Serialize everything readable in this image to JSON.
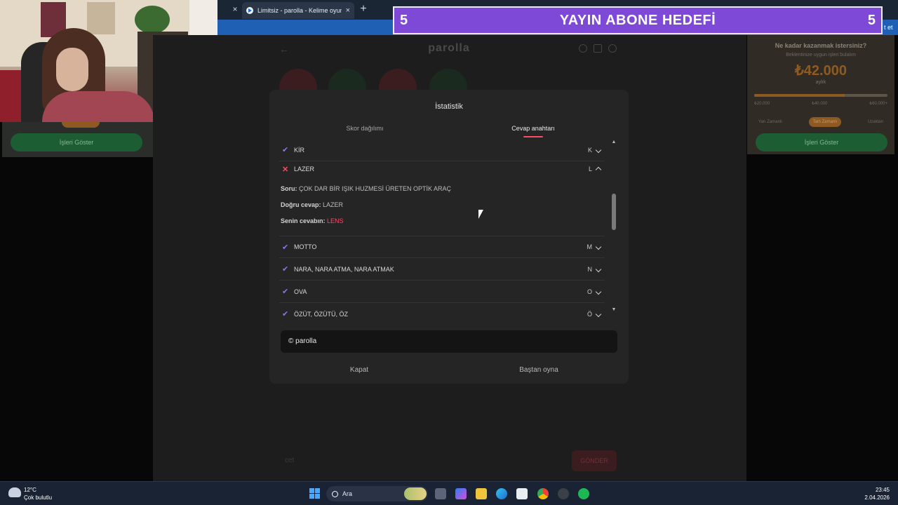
{
  "browser": {
    "prev_tab_close": "×",
    "active_tab": {
      "title": "Limitsiz - parolla - Kelime oyunu",
      "close": "×"
    },
    "new_tab": "+"
  },
  "goal_banner": {
    "left_count": "5",
    "title": "YAYIN ABONE HEDEFİ",
    "right_count": "5"
  },
  "corner_text": "t et",
  "ads": {
    "left_button": "İşleri Göster",
    "right": {
      "question": "Ne kadar kazanmak istersiniz?",
      "subtitle": "Beklentinize uygun işleri bulalım",
      "amount": "₺42.000",
      "period": "aylık",
      "progress": 0.68,
      "ticks": [
        "₺20.000",
        "₺40.000",
        "₺60.000+"
      ],
      "chips": [
        "Yarı Zamanlı",
        "Tam Zamanlı",
        "Uzaktan"
      ],
      "button": "İşleri Göster"
    }
  },
  "page": {
    "logo": "parolla",
    "back": "←",
    "input_placeholder": "cet",
    "submit": "GÖNDER"
  },
  "modal": {
    "title": "İstatistik",
    "tabs": {
      "score": "Skor dağılımı",
      "answers": "Cevap anahtarı"
    },
    "rows": [
      {
        "icon": "check-icon",
        "word": "KİR",
        "letter": "K",
        "expanded": false,
        "correct": true
      },
      {
        "icon": "cross-icon",
        "word": "LAZER",
        "letter": "L",
        "expanded": true,
        "correct": false
      },
      {
        "icon": "check-icon",
        "word": "MOTTO",
        "letter": "M",
        "expanded": false,
        "correct": true
      },
      {
        "icon": "check-icon",
        "word": "NARA, NARA ATMA, NARA ATMAK",
        "letter": "N",
        "expanded": false,
        "correct": true
      },
      {
        "icon": "check-icon",
        "word": "OVA",
        "letter": "O",
        "expanded": false,
        "correct": true
      },
      {
        "icon": "check-icon",
        "word": "ÖZÜT, ÖZÜTÜ, ÖZ",
        "letter": "Ö",
        "expanded": false,
        "correct": true
      }
    ],
    "detail": {
      "question_label": "Soru:",
      "question": "ÇOK DAR BİR IŞIK HUZMESİ ÜRETEN OPTİK ARAÇ",
      "correct_label": "Doğru cevap:",
      "correct": "LAZER",
      "yours_label": "Senin cevabın:",
      "yours": "LENS"
    },
    "copyright": "© parolla",
    "close": "Kapat",
    "restart": "Baştan oyna"
  },
  "taskbar": {
    "weather_temp": "12°C",
    "weather_desc": "Çok bulutlu",
    "search": "Ara",
    "time": "23:45",
    "date": "2.04.2026"
  },
  "colors": {
    "accent": "#ff4a5f",
    "check": "#8c78e8",
    "banner": "#7e49d6"
  }
}
